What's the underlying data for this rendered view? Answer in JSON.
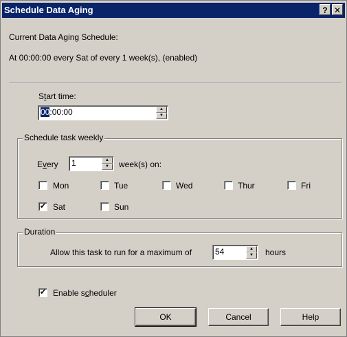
{
  "title_bar": {
    "title": "Schedule Data Aging",
    "help_glyph": "?",
    "close_glyph": "✕"
  },
  "current_schedule": {
    "label": "Current Data Aging Schedule:",
    "value": "At 00:00:00 every Sat of every 1 week(s), (enabled)"
  },
  "start_time": {
    "label_pre": "S",
    "label_underline": "t",
    "label_post": "art time:",
    "value_selected": "00",
    "value_rest": ":00:00"
  },
  "weekly": {
    "legend": "Schedule task weekly",
    "every_pre": "E",
    "every_underline": "v",
    "every_post": "ery",
    "every_value": "1",
    "weeks_on": "week(s) on:",
    "days": [
      {
        "label": "Mon",
        "checked": false
      },
      {
        "label": "Tue",
        "checked": false
      },
      {
        "label": "Wed",
        "checked": false
      },
      {
        "label": "Thur",
        "checked": false
      },
      {
        "label": "Fri",
        "checked": false
      },
      {
        "label": "Sat",
        "checked": true
      },
      {
        "label": "Sun",
        "checked": false
      }
    ]
  },
  "duration": {
    "legend": "Duration",
    "prefix": "Allow this task to run for a maximum of",
    "value": "54",
    "suffix": "hours"
  },
  "enable_scheduler": {
    "label_pre": "Enable s",
    "label_underline": "c",
    "label_post": "heduler",
    "checked": true
  },
  "buttons": {
    "ok": "OK",
    "cancel": "Cancel",
    "help": "Help"
  },
  "check_glyph": "✔",
  "colors": {
    "title_bar": "#0a246a",
    "dialog_face": "#d4d0c8",
    "selection": "#0a246a"
  }
}
